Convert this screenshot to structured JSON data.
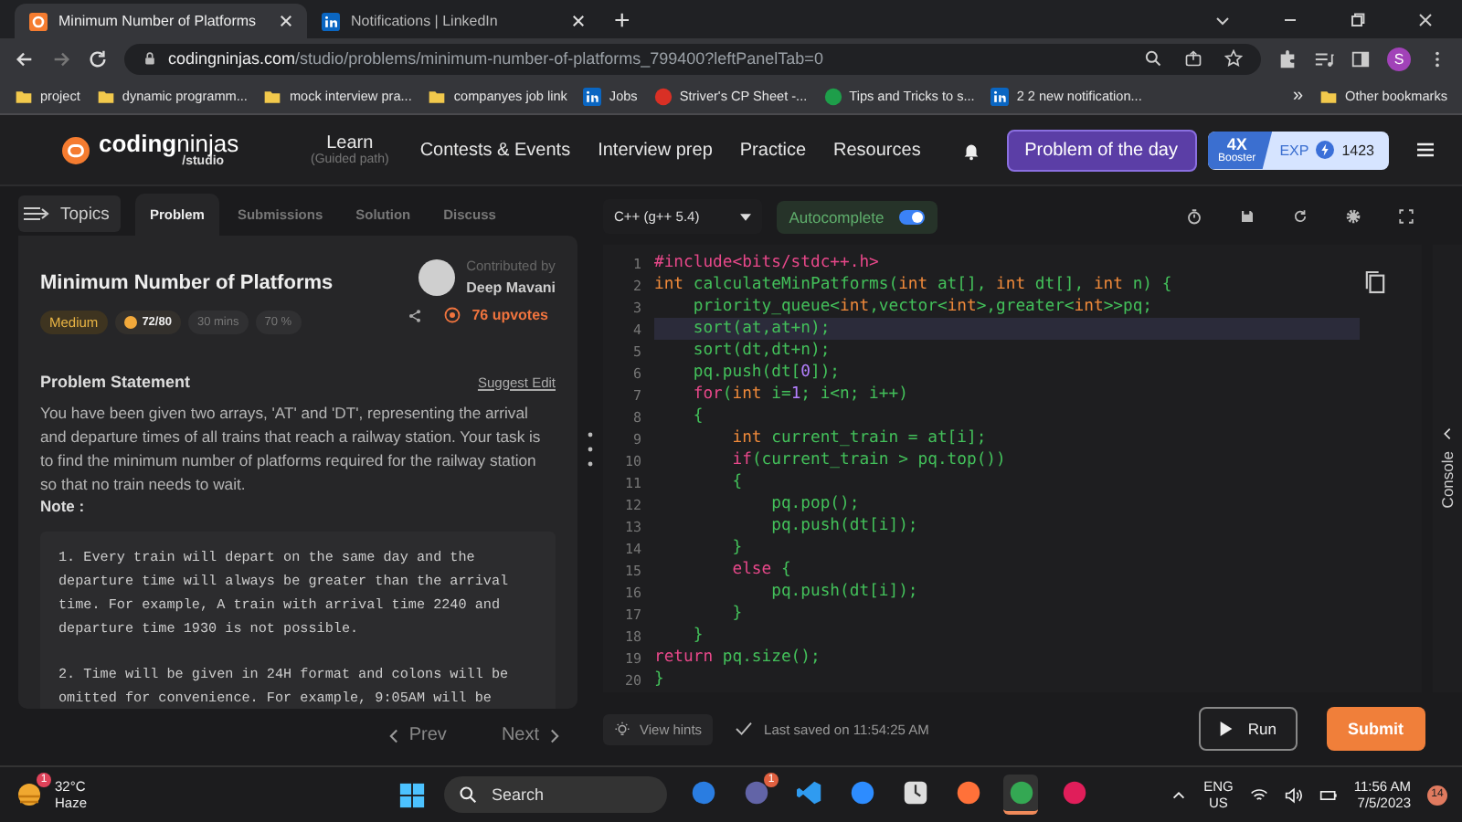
{
  "browser": {
    "tabs": [
      {
        "title": "Minimum Number of Platforms",
        "kind": "cn",
        "selected": true
      },
      {
        "title": "Notifications | LinkedIn",
        "kind": "linkedin",
        "selected": false
      }
    ],
    "new_tab": "+",
    "address": {
      "domain": "codingninjas.com",
      "path": "/studio/problems/minimum-number-of-platforms_799400?leftPanelTab=0"
    },
    "profile": "S",
    "bookmarks": [
      {
        "label": "project",
        "kind": "folder"
      },
      {
        "label": "dynamic programm...",
        "kind": "folder"
      },
      {
        "label": "mock interview pra...",
        "kind": "folder"
      },
      {
        "label": "companyes job link",
        "kind": "folder"
      },
      {
        "label": "Jobs",
        "kind": "linkedin"
      },
      {
        "label": "Striver's CP Sheet -...",
        "kind": "red"
      },
      {
        "label": "Tips and Tricks to s...",
        "kind": "green"
      },
      {
        "label": "2 2 new notification...",
        "kind": "linkedin"
      }
    ],
    "more": "»",
    "other_bookmarks": "Other bookmarks"
  },
  "site": {
    "logo": "**coding**ninjas",
    "logo_sub": "/studio",
    "nav": [
      {
        "label": "Learn",
        "sub": "(Guided path)"
      },
      {
        "label": "Contests & Events"
      },
      {
        "label": "Interview prep"
      },
      {
        "label": "Practice"
      },
      {
        "label": "Resources"
      }
    ],
    "potd": "Problem of the day",
    "booster": "4X",
    "booster_label": "Booster",
    "exp_label": "EXP",
    "exp": "1423"
  },
  "left": {
    "topics": "Topics",
    "tabs": [
      {
        "label": "Problem",
        "selected": true
      },
      {
        "label": "Submissions",
        "selected": false
      },
      {
        "label": "Solution",
        "selected": false
      },
      {
        "label": "Discuss",
        "selected": false
      }
    ],
    "title": "Minimum Number of Platforms",
    "contributed_by": "Contributed by",
    "author": "Deep Mavani",
    "tags": [
      {
        "label": "Medium",
        "kind": "difficulty"
      },
      {
        "label": "72/80",
        "kind": "score"
      },
      {
        "label": "30 mins",
        "kind": "plain"
      },
      {
        "label": "70 %",
        "kind": "plain"
      }
    ],
    "upvotes": "76 upvotes",
    "statement_heading": "Problem Statement",
    "suggest_edit": "Suggest Edit",
    "statement": "You have been given two arrays, 'AT' and 'DT', representing the arrival and departure times of all trains that reach a railway station. Your task is to find the minimum number of platforms required for the railway station so that no train needs to wait.",
    "note_heading": "Note :",
    "note_paragraphs": [
      [
        "1. Every train will depart on the same day and the",
        "departure time will always be greater than the arrival",
        "time. For example, A train with arrival time 2240 and",
        "departure time 1930 is not possible."
      ],
      [
        "2. Time will be given in 24H format and colons will be",
        "omitted for convenience. For example, 9:05AM will be"
      ]
    ],
    "prev": "Prev",
    "next": "Next"
  },
  "editor": {
    "language": "C++ (g++ 5.4)",
    "autocomplete": {
      "label": "Autocomplete",
      "on": true
    },
    "lines": [
      {
        "number": "1",
        "current": false,
        "tokens": [
          {
            "kind": "kw",
            "text": "#include<bits/stdc++.h>"
          }
        ]
      },
      {
        "number": "2",
        "current": false,
        "tokens": [
          {
            "kind": "ty",
            "text": "int"
          },
          {
            "kind": "id",
            "text": " calculateMinPatforms("
          },
          {
            "kind": "ty",
            "text": "int"
          },
          {
            "kind": "id",
            "text": " at[], "
          },
          {
            "kind": "ty",
            "text": "int"
          },
          {
            "kind": "id",
            "text": " dt[], "
          },
          {
            "kind": "ty",
            "text": "int"
          },
          {
            "kind": "id",
            "text": " n) {"
          }
        ]
      },
      {
        "number": "3",
        "current": false,
        "tokens": [
          {
            "kind": "id",
            "text": "    priority_queue<"
          },
          {
            "kind": "ty",
            "text": "int"
          },
          {
            "kind": "id",
            "text": ",vector<"
          },
          {
            "kind": "ty",
            "text": "int"
          },
          {
            "kind": "id",
            "text": ">,greater<"
          },
          {
            "kind": "ty",
            "text": "int"
          },
          {
            "kind": "id",
            "text": ">>pq;"
          }
        ]
      },
      {
        "number": "4",
        "current": true,
        "tokens": [
          {
            "kind": "id",
            "text": "    sort(at,at+n);"
          }
        ]
      },
      {
        "number": "5",
        "current": false,
        "tokens": [
          {
            "kind": "id",
            "text": "    sort(dt,dt+n);"
          }
        ]
      },
      {
        "number": "6",
        "current": false,
        "tokens": [
          {
            "kind": "id",
            "text": "    pq.push(dt["
          },
          {
            "kind": "num",
            "text": "0"
          },
          {
            "kind": "id",
            "text": "]);"
          }
        ]
      },
      {
        "number": "7",
        "current": false,
        "tokens": [
          {
            "kind": "kw",
            "text": "    for"
          },
          {
            "kind": "id",
            "text": "("
          },
          {
            "kind": "ty",
            "text": "int"
          },
          {
            "kind": "id",
            "text": " i="
          },
          {
            "kind": "num",
            "text": "1"
          },
          {
            "kind": "id",
            "text": "; i<n; i++)"
          }
        ]
      },
      {
        "number": "8",
        "current": false,
        "tokens": [
          {
            "kind": "id",
            "text": "    {"
          }
        ]
      },
      {
        "number": "9",
        "current": false,
        "tokens": [
          {
            "kind": "ty",
            "text": "        int"
          },
          {
            "kind": "id",
            "text": " current_train = at[i];"
          }
        ]
      },
      {
        "number": "10",
        "current": false,
        "tokens": [
          {
            "kind": "kw",
            "text": "        if"
          },
          {
            "kind": "id",
            "text": "(current_train > pq.top())"
          }
        ]
      },
      {
        "number": "11",
        "current": false,
        "tokens": [
          {
            "kind": "id",
            "text": "        {"
          }
        ]
      },
      {
        "number": "12",
        "current": false,
        "tokens": [
          {
            "kind": "id",
            "text": "            pq.pop();"
          }
        ]
      },
      {
        "number": "13",
        "current": false,
        "tokens": [
          {
            "kind": "id",
            "text": "            pq.push(dt[i]);"
          }
        ]
      },
      {
        "number": "14",
        "current": false,
        "tokens": [
          {
            "kind": "id",
            "text": "        }"
          }
        ]
      },
      {
        "number": "15",
        "current": false,
        "tokens": [
          {
            "kind": "kw",
            "text": "        else"
          },
          {
            "kind": "id",
            "text": " {"
          }
        ]
      },
      {
        "number": "16",
        "current": false,
        "tokens": [
          {
            "kind": "id",
            "text": "            pq.push(dt[i]);"
          }
        ]
      },
      {
        "number": "17",
        "current": false,
        "tokens": [
          {
            "kind": "id",
            "text": "        }"
          }
        ]
      },
      {
        "number": "18",
        "current": false,
        "tokens": [
          {
            "kind": "id",
            "text": "    }"
          }
        ]
      },
      {
        "number": "19",
        "current": false,
        "tokens": [
          {
            "kind": "kw",
            "text": "return"
          },
          {
            "kind": "id",
            "text": " pq.size();"
          }
        ]
      },
      {
        "number": "20",
        "current": false,
        "tokens": [
          {
            "kind": "id",
            "text": "}"
          }
        ]
      }
    ],
    "console": "Console",
    "view_hints": "View hints",
    "last_saved": "Last saved on 11:54:25 AM",
    "run": "Run",
    "submit": "Submit"
  },
  "taskbar": {
    "temperature": "32°C",
    "weather": "Haze",
    "weather_badge": "1",
    "search": "Search",
    "apps": [
      {
        "kind": "bing",
        "active": false
      },
      {
        "kind": "teams",
        "badge": "1",
        "active": false
      },
      {
        "kind": "vscode",
        "active": false
      },
      {
        "kind": "zoom",
        "active": false
      },
      {
        "kind": "clock",
        "active": false
      },
      {
        "kind": "firefox",
        "active": false
      },
      {
        "kind": "chrome",
        "active": true
      },
      {
        "kind": "slack",
        "active": false
      }
    ],
    "language": "ENG",
    "region": "US",
    "time": "11:56 AM",
    "date": "7/5/2023",
    "notifications": "14"
  }
}
